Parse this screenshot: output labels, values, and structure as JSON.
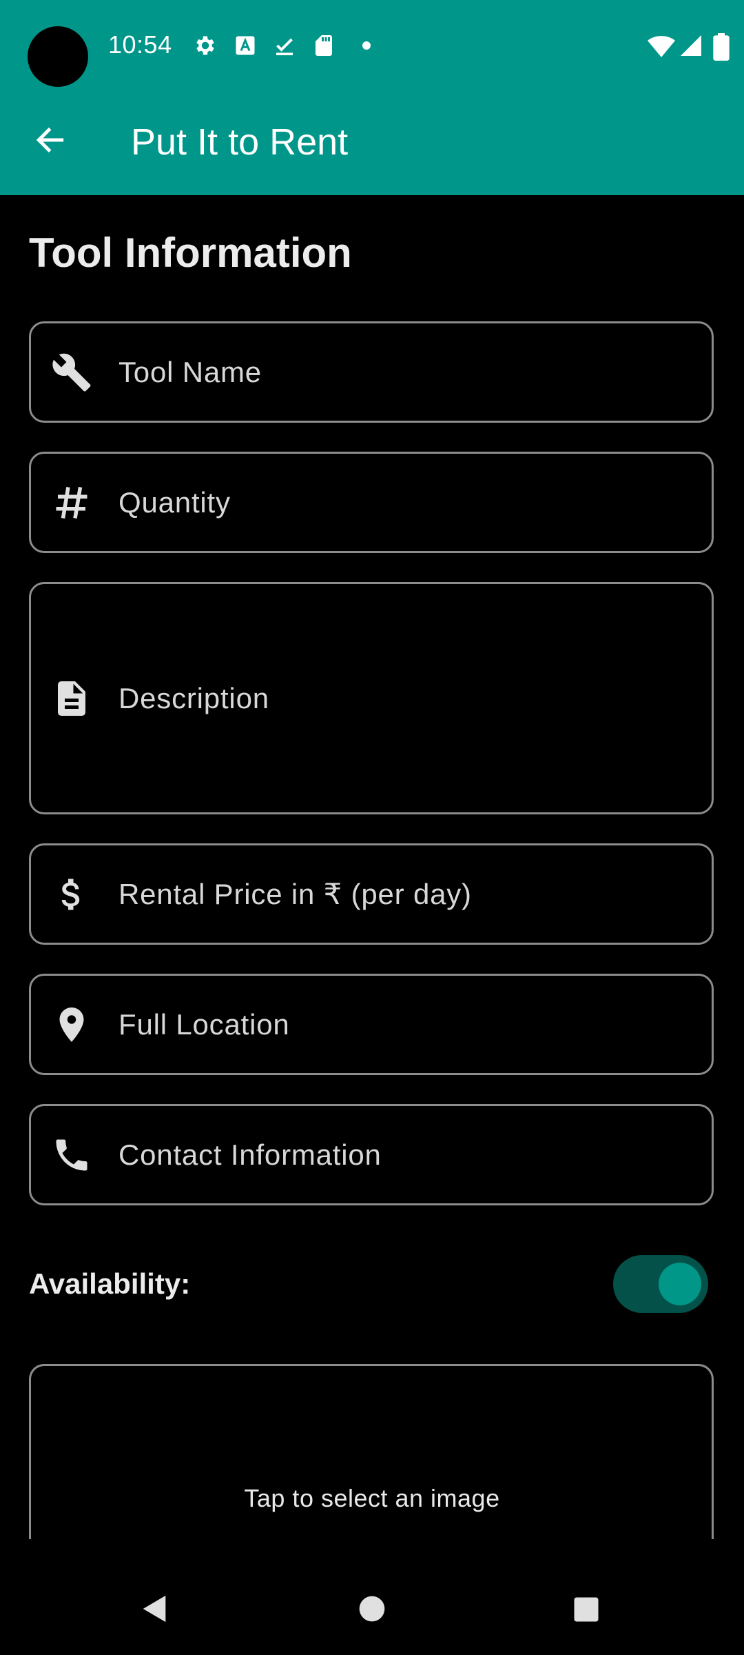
{
  "status_bar": {
    "time": "10:54",
    "icons": [
      "settings-icon",
      "text-a-icon",
      "download-done-icon",
      "sd-card-icon",
      "dot-icon",
      "wifi-icon",
      "signal-icon",
      "battery-icon"
    ]
  },
  "toolbar": {
    "title": "Put It to Rent",
    "back_icon": "arrow-back-icon"
  },
  "form": {
    "section_title": "Tool Information",
    "fields": [
      {
        "label": "Tool Name",
        "icon": "wrench-icon",
        "value": ""
      },
      {
        "label": "Quantity",
        "icon": "hash-icon",
        "value": ""
      },
      {
        "label": "Description",
        "icon": "document-icon",
        "value": ""
      },
      {
        "label": "Rental Price in ₹ (per day)",
        "icon": "dollar-icon",
        "value": ""
      },
      {
        "label": "Full Location",
        "icon": "location-pin-icon",
        "value": ""
      },
      {
        "label": "Contact Information",
        "icon": "phone-icon",
        "value": ""
      }
    ],
    "availability": {
      "label": "Availability:",
      "enabled": true
    },
    "image_picker": {
      "label": "Tap to select an image"
    }
  },
  "colors": {
    "appbar": "#00968a",
    "background": "#000000",
    "accent": "#009688",
    "toggle_track": "#04514a",
    "field_border": "#8c8c8c"
  },
  "nav_bar": {
    "buttons": [
      "nav-back-icon",
      "nav-home-icon",
      "nav-recents-icon"
    ]
  }
}
